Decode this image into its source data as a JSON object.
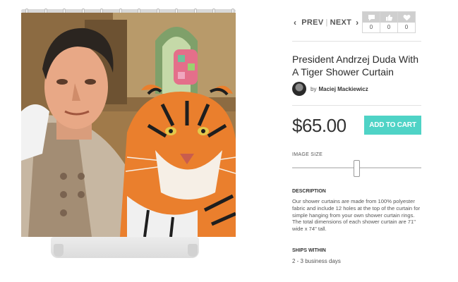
{
  "nav": {
    "prev_label": "PREV",
    "next_label": "NEXT"
  },
  "counts": [
    {
      "icon": "comment-icon",
      "value": "0"
    },
    {
      "icon": "thumbs-up-icon",
      "value": "0"
    },
    {
      "icon": "heart-icon",
      "value": "0"
    }
  ],
  "product": {
    "title": "President Andrzej Duda With A Tiger Shower Curtain",
    "artist_prefix": "by",
    "artist_name": "Maciej Mackiewicz",
    "price": "$65.00",
    "add_to_cart_label": "ADD TO CART",
    "image_size_label": "IMAGE SIZE",
    "image_size_level": 0.5,
    "description_label": "DESCRIPTION",
    "description_text": "Our shower curtains are made from 100% polyester fabric and include 12 holes at the top of the curtain for simple hanging from your own shower curtain rings. The total dimensions of each shower curtain are 71\" wide x 74\" tall.",
    "ships_label": "SHIPS WITHIN",
    "ships_text": "2 - 3 business days"
  },
  "colors": {
    "accent": "#4fd3c6",
    "text": "#333333",
    "muted": "#555555"
  }
}
